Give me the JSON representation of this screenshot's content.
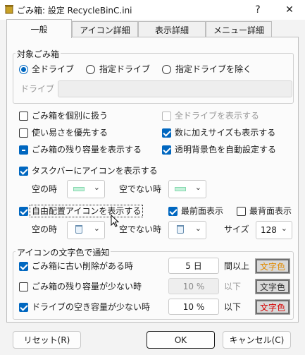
{
  "window": {
    "title": "ごみ箱: 設定  RecycleBinC.ini",
    "help": "?",
    "close": "✕"
  },
  "tabs": [
    {
      "label": "一般"
    },
    {
      "label": "アイコン詳細"
    },
    {
      "label": "表示詳細"
    },
    {
      "label": "メニュー詳細"
    }
  ],
  "target": {
    "group_label": "対象ごみ箱",
    "radio_all": "全ドライブ",
    "radio_specified": "指定ドライブ",
    "radio_except": "指定ドライブを除く",
    "drive_label": "ドライブ",
    "drive_value": ""
  },
  "options": {
    "individual": "ごみ箱を個別に扱う",
    "show_all_drives": "全ドライブを表示する",
    "usability": "使い易さを優先する",
    "show_size": "数に加えサイズも表示する",
    "show_remaining": "ごみ箱の残り容量を表示する",
    "auto_bg": "透明背景色を自動設定する",
    "taskbar": "タスクバーにアイコンを表示する",
    "empty_when": "空の時",
    "nonempty_when": "空でない時",
    "free_placement": "自由配置アイコンを表示する",
    "topmost": "最前面表示",
    "bottommost": "最背面表示",
    "size_label": "サイズ",
    "size_value": "128"
  },
  "notify": {
    "group_label": "アイコンの文字色で通知",
    "old_items": "ごみ箱に古い削除がある時",
    "old_value": "5 日",
    "old_suffix": "間以上",
    "remaining_low": "ごみ箱の残り容量が少ない時",
    "remaining_value": "10 %",
    "remaining_suffix": "以下",
    "drive_low": "ドライブの空き容量が少ない時",
    "drive_value": "10 %",
    "drive_suffix": "以下",
    "color_btn": "文字色"
  },
  "colors": {
    "old_color": "#e08a00",
    "remaining_color": "#333333",
    "drive_color": "#d60000",
    "accent": "#0067c0"
  },
  "buttons": {
    "reset": "リセット(R)",
    "ok": "OK",
    "cancel": "キャンセル(C)"
  }
}
